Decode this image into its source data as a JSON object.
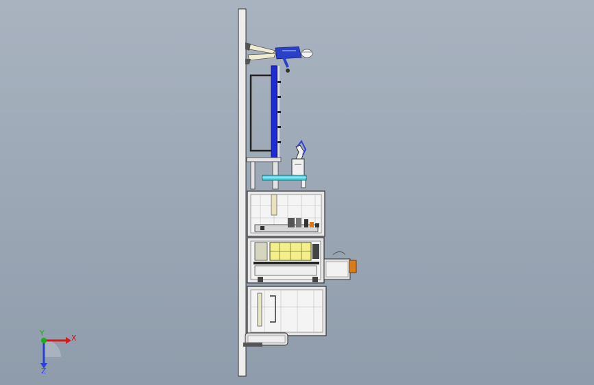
{
  "viewport": {
    "background_top": "#a9b3c0",
    "background_bottom": "#8f9cab"
  },
  "triad": {
    "x_label": "X",
    "y_label": "Y",
    "z_label": "Z",
    "x_color": "#d41a1a",
    "y_color": "#18b018",
    "z_color": "#2a3fd8"
  },
  "model": {
    "frame_color": "#e8e8e8",
    "outline_color": "#3a3a3a",
    "accent_blue": "#1f2bd8",
    "accent_cyan": "#55d8e8",
    "accent_yellow": "#f3ef8a",
    "accent_orange": "#d97b18",
    "figure_icon": "human-figure-icon"
  }
}
